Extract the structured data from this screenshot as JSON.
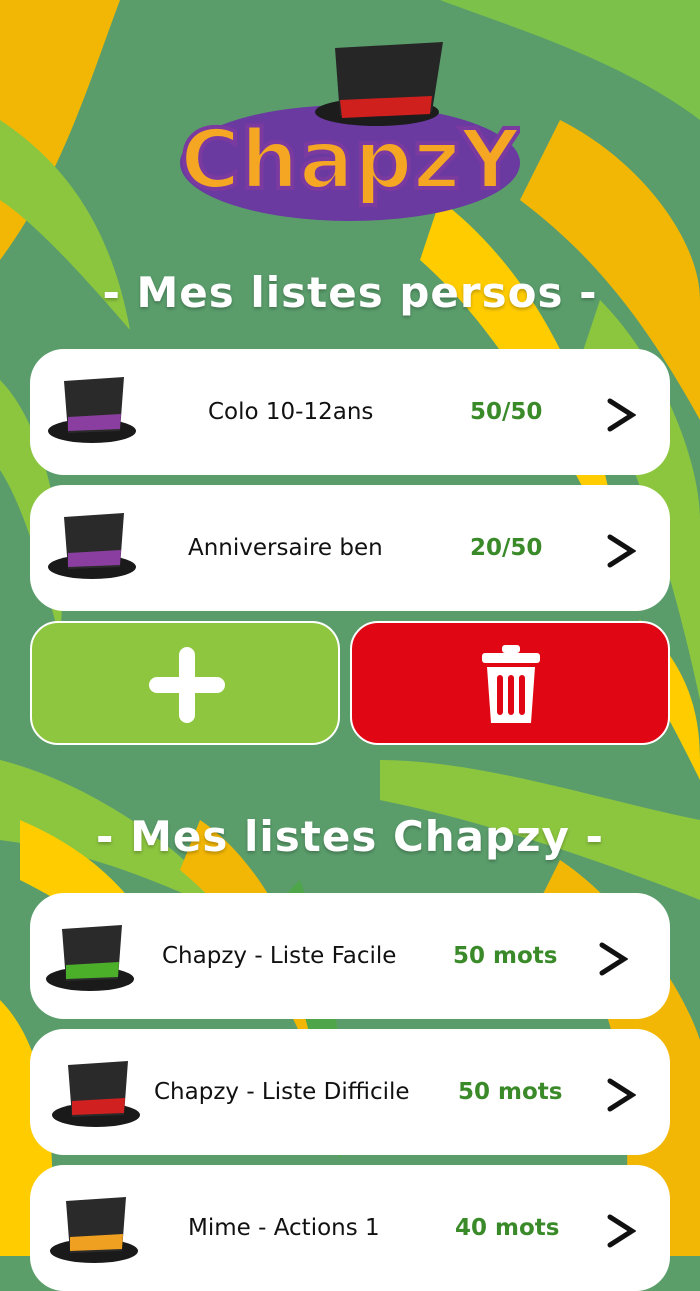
{
  "app": {
    "logo_text": "ChapzY"
  },
  "sections": {
    "personal": {
      "title": "- Mes listes persos -"
    },
    "chapzy": {
      "title": "- Mes listes Chapzy -"
    }
  },
  "personal_lists": [
    {
      "name": "Colo 10-12ans",
      "count": "50/50",
      "band_color": "#8a3fa0",
      "icon": "hat-icon"
    },
    {
      "name": "Anniversaire ben",
      "count": "20/50",
      "band_color": "#8a3fa0",
      "icon": "hat-icon"
    }
  ],
  "chapzy_lists": [
    {
      "name": "Chapzy - Liste Facile",
      "count": "50 mots",
      "band_color": "#4caf2a",
      "icon": "hat-icon"
    },
    {
      "name": "Chapzy - Liste Difficile",
      "count": "50 mots",
      "band_color": "#d02020",
      "icon": "hat-icon"
    },
    {
      "name": "Mime - Actions 1",
      "count": "40 mots",
      "band_color": "#f0a020",
      "icon": "hat-icon"
    }
  ],
  "actions": {
    "add": {
      "icon": "plus-icon",
      "color": "#8ec63f"
    },
    "delete": {
      "icon": "trash-icon",
      "color": "#e10613"
    }
  },
  "row_arrow": ">"
}
